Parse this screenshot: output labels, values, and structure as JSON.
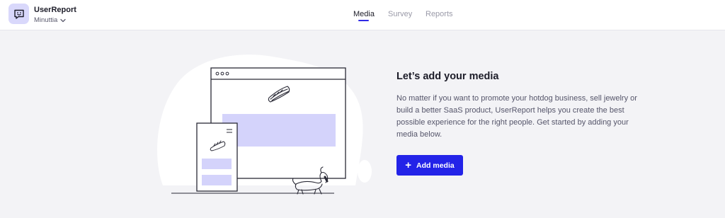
{
  "header": {
    "app_name": "UserReport",
    "org_name": "Minuttia",
    "logo_icon": "chat-smile-icon",
    "tabs": [
      {
        "label": "Media",
        "active": true
      },
      {
        "label": "Survey",
        "active": false
      },
      {
        "label": "Reports",
        "active": false
      }
    ]
  },
  "empty_state": {
    "title": "Let’s add your media",
    "description": "No matter if you want to promote your hotdog business, sell jewelry or build a better SaaS product, UserReport helps you create the best possible experience for the right people. Get started by adding your media below.",
    "add_button": "Add media",
    "illustration": "browser-mobile-dog-illustration"
  },
  "colors": {
    "accent": "#2323e8",
    "logo_bg": "#d9d8fb",
    "placeholder": "#d4d3fb",
    "page_bg": "#f3f3f6"
  }
}
